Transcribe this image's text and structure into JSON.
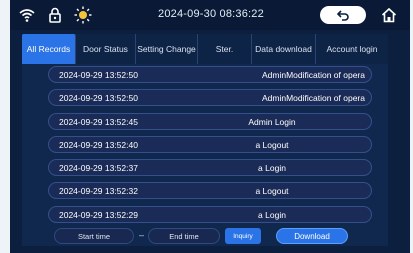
{
  "status_bar": {
    "datetime": "2024-09-30 08:36:22",
    "icons": [
      "wifi-icon",
      "lock-icon",
      "sun-icon",
      "back-icon",
      "home-icon"
    ]
  },
  "tabs": [
    {
      "label": "All Records",
      "active": true
    },
    {
      "label": "Door Status",
      "active": false
    },
    {
      "label": "Setting Change",
      "active": false
    },
    {
      "label": "Ster.",
      "active": false
    },
    {
      "label": "Data download",
      "active": false
    },
    {
      "label": "Account login",
      "active": false
    }
  ],
  "records": [
    {
      "time": "2024-09-29 13:52:50",
      "event": "AdminModification of opera"
    },
    {
      "time": "2024-09-29 13:52:50",
      "event": "AdminModification of opera"
    },
    {
      "time": "2024-09-29 13:52:45",
      "event": "Admin Login"
    },
    {
      "time": "2024-09-29 13:52:40",
      "event": "a Logout"
    },
    {
      "time": "2024-09-29 13:52:37",
      "event": "a Login"
    },
    {
      "time": "2024-09-29 13:52:32",
      "event": "a Logout"
    },
    {
      "time": "2024-09-29 13:52:29",
      "event": "a Login"
    }
  ],
  "filters": {
    "start_time": "Start time",
    "separator": "–",
    "end_time": "End time",
    "inquiry": "Inquiry",
    "download": "Download"
  },
  "colors": {
    "accent": "#2b74e8",
    "background": "#0c1f3f",
    "row": "#1b2b57"
  }
}
